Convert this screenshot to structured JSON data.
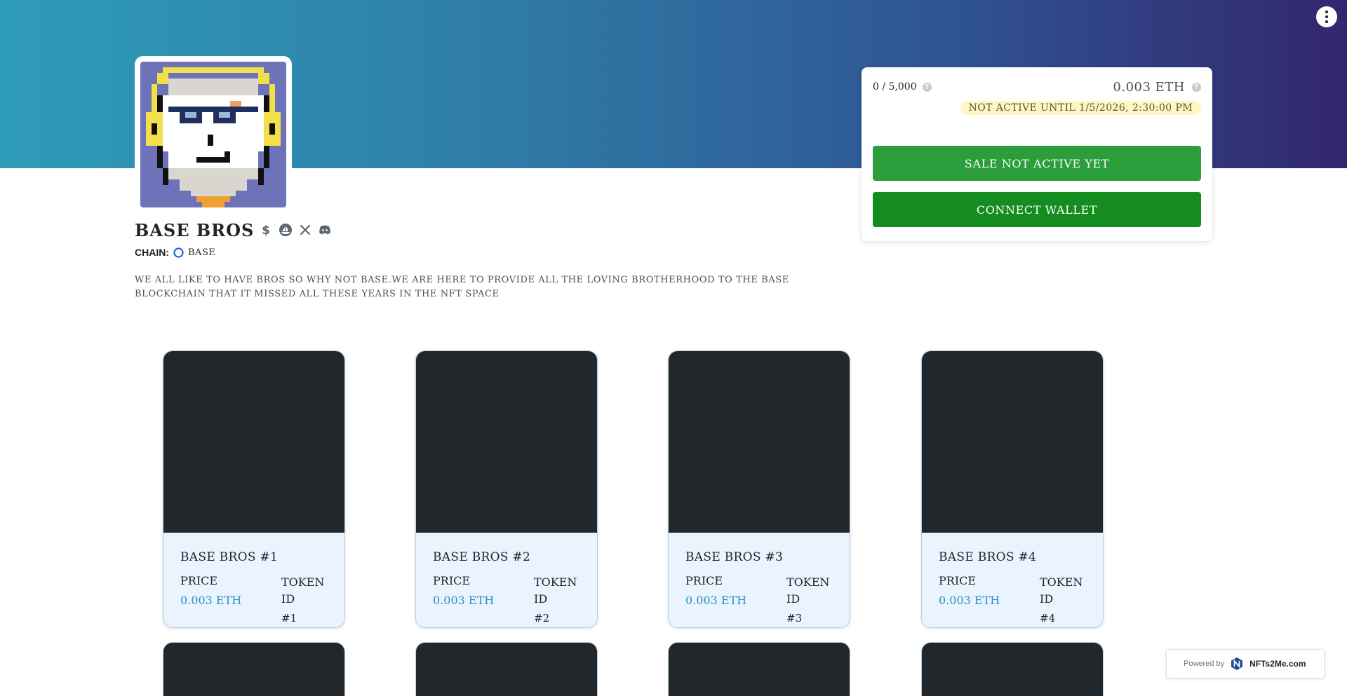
{
  "menu": {
    "icon": "vertical-dots-icon"
  },
  "collection": {
    "title": "BASE BROS",
    "chain_label": "CHAIN:",
    "chain_value": "BASE",
    "description": "WE ALL LIKE TO HAVE BROS SO WHY NOT BASE.WE ARE HERE TO PROVIDE ALL THE LOVING BROTHERHOOD TO THE BASE BLOCKCHAIN THAT IT MISSED ALL THESE YEARS IN THE NFT SPACE",
    "social_icons": [
      "dollar-icon",
      "opensea-icon",
      "x-icon",
      "discord-icon"
    ]
  },
  "sale": {
    "supply": "0 / 5,000",
    "price": "0.003 ETH",
    "status": "NOT ACTIVE UNTIL 1/5/2026, 2:30:00 PM",
    "sale_button": "SALE NOT ACTIVE YET",
    "connect_button": "CONNECT WALLET",
    "help_glyph": "?"
  },
  "cards": [
    {
      "title": "BASE BROS #1",
      "price_label": "PRICE",
      "price": "0.003 ETH",
      "token_label": "TOKEN ID",
      "token_id": "#1"
    },
    {
      "title": "BASE BROS #2",
      "price_label": "PRICE",
      "price": "0.003 ETH",
      "token_label": "TOKEN ID",
      "token_id": "#2"
    },
    {
      "title": "BASE BROS #3",
      "price_label": "PRICE",
      "price": "0.003 ETH",
      "token_label": "TOKEN ID",
      "token_id": "#3"
    },
    {
      "title": "BASE BROS #4",
      "price_label": "PRICE",
      "price": "0.003 ETH",
      "token_label": "TOKEN ID",
      "token_id": "#4"
    }
  ],
  "powered": {
    "label": "Powered by",
    "brand": "NFTs2Me.com"
  },
  "colors": {
    "banner_start": "#2e9cb8",
    "banner_end": "#33266e",
    "sale_button": "#2b9d3b",
    "connect_button": "#148c1f",
    "price_accent": "#2b8fc0",
    "badge_bg": "#fff7c2"
  }
}
